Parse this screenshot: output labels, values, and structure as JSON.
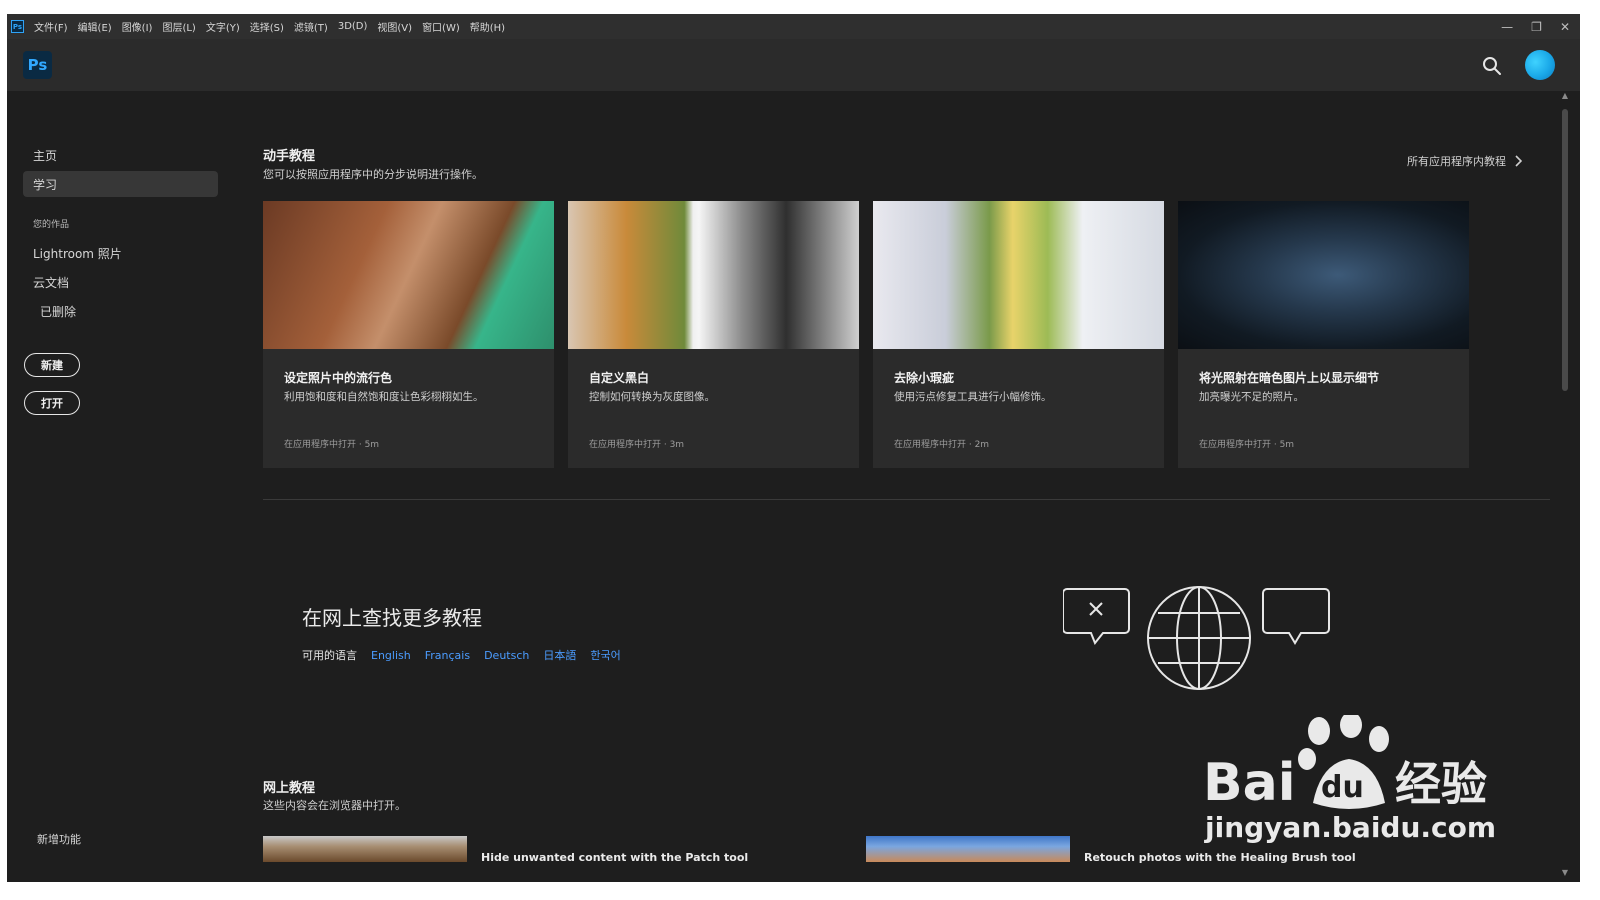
{
  "menubar": {
    "app_icon": "Ps",
    "items": [
      "文件(F)",
      "编辑(E)",
      "图像(I)",
      "图层(L)",
      "文字(Y)",
      "选择(S)",
      "滤镜(T)",
      "3D(D)",
      "视图(V)",
      "窗口(W)",
      "帮助(H)"
    ],
    "minimize": "—",
    "restore": "❐",
    "close": "✕"
  },
  "header": {
    "logo": "Ps",
    "search_icon": "search-icon",
    "avatar_color": "#1aa8e8"
  },
  "sidebar": {
    "home": "主页",
    "learn": "学习",
    "your_work_heading": "您的作品",
    "lightroom": "Lightroom 照片",
    "cloud_docs": "云文档",
    "deleted": "已删除",
    "new_button": "新建",
    "open_button": "打开",
    "whats_new": "新增功能"
  },
  "hands_on": {
    "title": "动手教程",
    "subtitle": "您可以按照应用程序中的分步说明进行操作。",
    "all_link": "所有应用程序内教程",
    "cards": [
      {
        "title": "设定照片中的流行色",
        "desc": "利用饱和度和自然饱和度让色彩栩栩如生。",
        "meta": "在应用程序中打开 · 5m"
      },
      {
        "title": "自定义黑白",
        "desc": "控制如何转换为灰度图像。",
        "meta": "在应用程序中打开 · 3m"
      },
      {
        "title": "去除小瑕疵",
        "desc": "使用污点修复工具进行小幅修饰。",
        "meta": "在应用程序中打开 · 2m"
      },
      {
        "title": "将光照射在暗色图片上以显示细节",
        "desc": "加亮曝光不足的照片。",
        "meta": "在应用程序中打开 · 5m"
      }
    ]
  },
  "web_tutorials": {
    "title": "在网上查找更多教程",
    "languages_label": "可用的语言",
    "languages": [
      "English",
      "Français",
      "Deutsch",
      "日本語",
      "한국어"
    ],
    "link_color": "#4b9cff"
  },
  "online": {
    "title": "网上教程",
    "subtitle": "这些内容会在浏览器中打开。",
    "items": [
      {
        "title": "Hide unwanted content with the Patch tool"
      },
      {
        "title": "Retouch photos with the Healing Brush tool"
      }
    ]
  },
  "watermark": {
    "brand": "Bai",
    "brand2": "du",
    "cn": "经验",
    "url": "jingyan.baidu.com"
  }
}
